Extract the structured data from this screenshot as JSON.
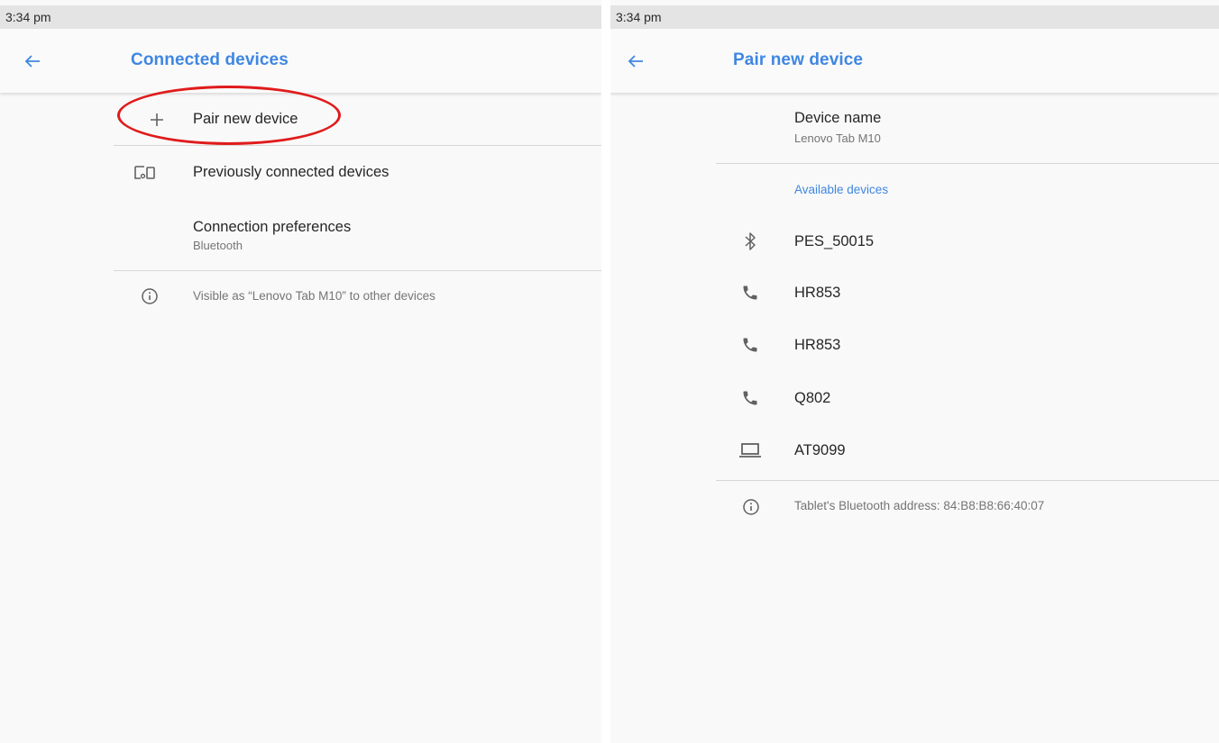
{
  "left": {
    "status_time": "3:34 pm",
    "title": "Connected devices",
    "items": [
      {
        "label": "Pair new device"
      },
      {
        "label": "Previously connected devices"
      },
      {
        "label": "Connection preferences",
        "sublabel": "Bluetooth"
      }
    ],
    "footer": "Visible as “Lenovo Tab M10” to other devices"
  },
  "right": {
    "status_time": "3:34 pm",
    "title": "Pair new device",
    "device_name": {
      "label": "Device name",
      "value": "Lenovo Tab M10"
    },
    "section_header": "Available devices",
    "devices": [
      {
        "name": "PES_50015",
        "icon": "bluetooth-icon"
      },
      {
        "name": "HR853",
        "icon": "phone-icon"
      },
      {
        "name": "HR853",
        "icon": "phone-icon"
      },
      {
        "name": "Q802",
        "icon": "phone-icon"
      },
      {
        "name": "AT9099",
        "icon": "laptop-icon"
      }
    ],
    "footer": "Tablet's Bluetooth address: 84:B8:B8:66:40:07"
  },
  "colors": {
    "accent": "#3f87e2",
    "annotation": "#e01b1b"
  }
}
